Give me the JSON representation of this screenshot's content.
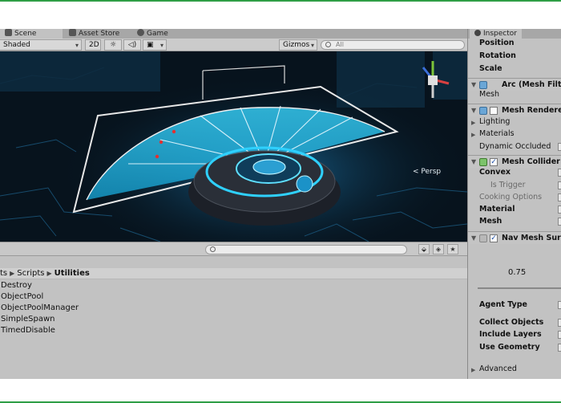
{
  "scene_tabs": {
    "scene": "Scene",
    "asset_store": "Asset Store",
    "game": "Game"
  },
  "scene_toolbar": {
    "shading_mode": "Shaded",
    "mode_2d": "2D",
    "gizmos": "Gizmos",
    "search_placeholder": "All"
  },
  "viewport": {
    "persp_label": "< Persp",
    "gizmo_axis_y": "y",
    "gizmo_axis_x": "x",
    "gizmo_axis_z": "z"
  },
  "project": {
    "breadcrumb": [
      "ts",
      "Scripts",
      "Utilities"
    ],
    "files": [
      "Destroy",
      "ObjectPool",
      "ObjectPoolManager",
      "SimpleSpawn",
      "TimedDisable"
    ]
  },
  "inspector": {
    "tab_title": "Inspector",
    "transform_rows": [
      "Position",
      "Rotation",
      "Scale"
    ],
    "mesh_filter": {
      "title": "Arc (Mesh Filt",
      "mesh_label": "Mesh"
    },
    "mesh_renderer": {
      "title": "Mesh Rendere",
      "rows": [
        "Lighting",
        "Materials",
        "Dynamic Occluded"
      ]
    },
    "mesh_collider": {
      "title": "Mesh Collider",
      "convex": "Convex",
      "is_trigger": "Is Trigger",
      "cooking_options": "Cooking Options",
      "material": "Material",
      "mesh": "Mesh"
    },
    "nav_mesh": {
      "title": "Nav Mesh Surf",
      "slider_value": "0.75",
      "agent_type": "Agent Type",
      "collect_objects": "Collect Objects",
      "include_layers": "Include Layers",
      "use_geometry": "Use Geometry",
      "advanced": "Advanced"
    }
  },
  "colors": {
    "accent_cyan": "#29c6ef",
    "frame_green": "#2f9e46",
    "panel_gray": "#c2c2c2"
  }
}
